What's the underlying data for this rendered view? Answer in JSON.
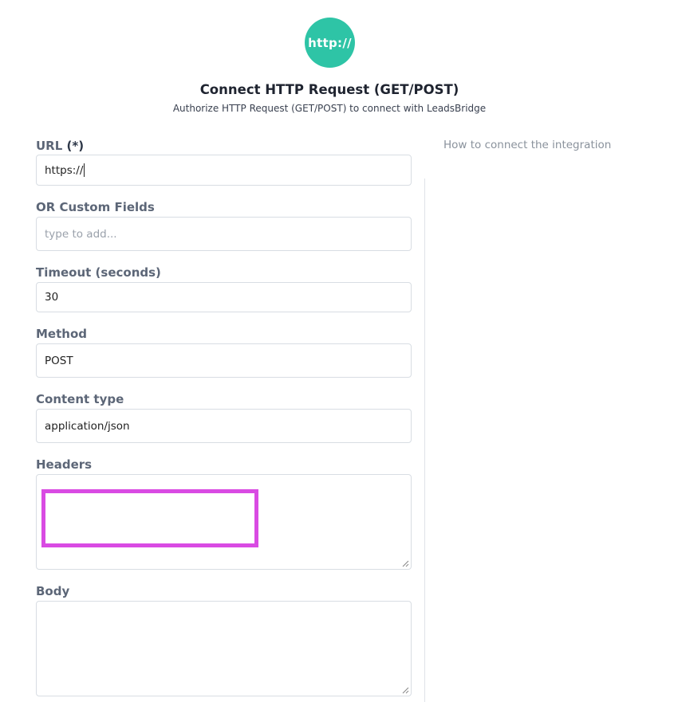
{
  "header": {
    "logo_text": "http://",
    "title": "Connect HTTP Request (GET/POST)",
    "subtitle": "Authorize HTTP Request (GET/POST) to connect with LeadsBridge"
  },
  "side": {
    "help_link": "How to connect the integration"
  },
  "form": {
    "url": {
      "label": "URL",
      "required_marker": "(*)",
      "value": "https://"
    },
    "custom_fields": {
      "label": "OR Custom Fields",
      "placeholder": "type to add..."
    },
    "timeout": {
      "label": "Timeout (seconds)",
      "value": "30"
    },
    "method": {
      "label": "Method",
      "value": "POST"
    },
    "content_type": {
      "label": "Content type",
      "value": "application/json"
    },
    "headers": {
      "label": "Headers",
      "value": ""
    },
    "body": {
      "label": "Body",
      "value": ""
    }
  },
  "colors": {
    "brand": "#2ec4a6",
    "highlight": "#d94be3"
  }
}
